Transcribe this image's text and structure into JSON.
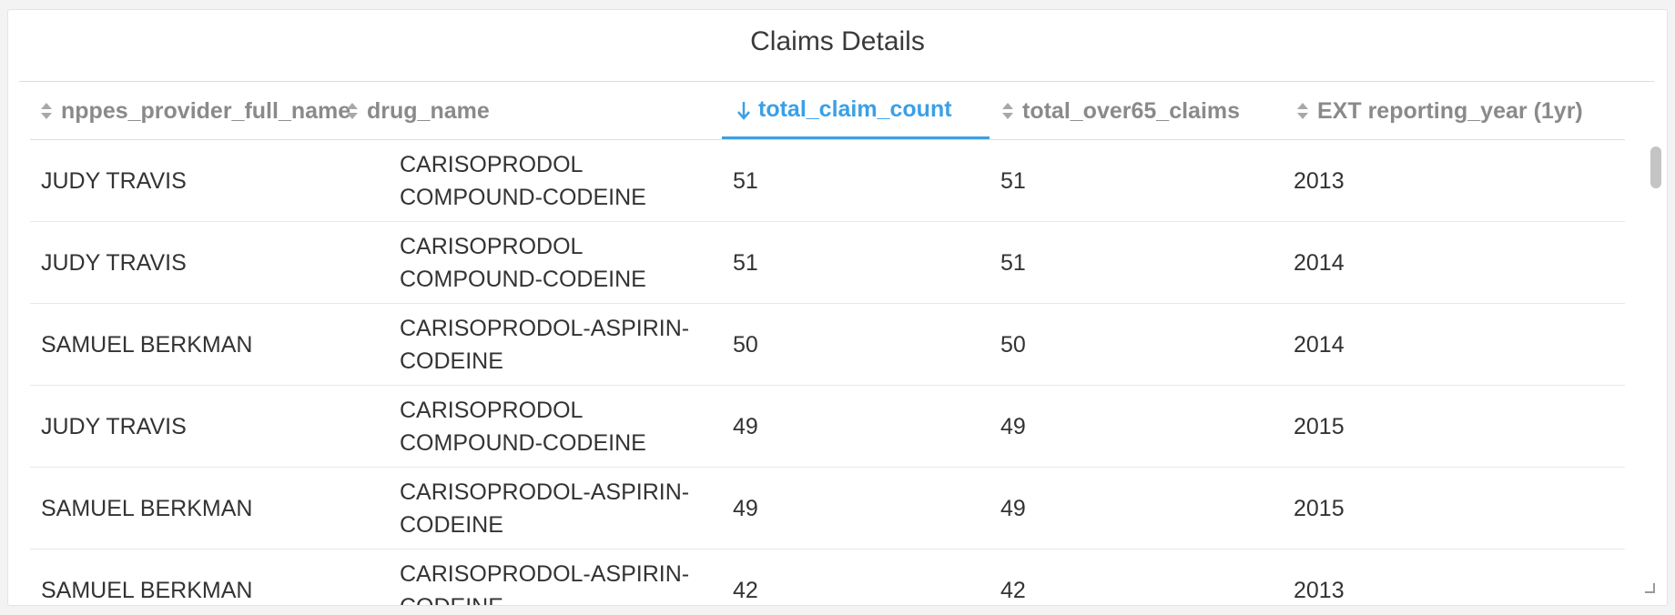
{
  "panel": {
    "title": "Claims Details"
  },
  "table": {
    "columns": [
      {
        "label": "nppes_provider_full_name",
        "sort": "none"
      },
      {
        "label": "drug_name",
        "sort": "none"
      },
      {
        "label": "total_claim_count",
        "sort": "desc"
      },
      {
        "label": "total_over65_claims",
        "sort": "none"
      },
      {
        "label": "EXT reporting_year (1yr)",
        "sort": "none"
      }
    ],
    "rows": [
      {
        "provider": "JUDY TRAVIS",
        "drug_line1": "CARISOPRODOL",
        "drug_line2": "COMPOUND-CODEINE",
        "total_claim_count": "51",
        "total_over65_claims": "51",
        "year": "2013"
      },
      {
        "provider": "JUDY TRAVIS",
        "drug_line1": "CARISOPRODOL",
        "drug_line2": "COMPOUND-CODEINE",
        "total_claim_count": "51",
        "total_over65_claims": "51",
        "year": "2014"
      },
      {
        "provider": "SAMUEL BERKMAN",
        "drug_line1": "CARISOPRODOL-ASPIRIN-",
        "drug_line2": "CODEINE",
        "total_claim_count": "50",
        "total_over65_claims": "50",
        "year": "2014"
      },
      {
        "provider": "JUDY TRAVIS",
        "drug_line1": "CARISOPRODOL",
        "drug_line2": "COMPOUND-CODEINE",
        "total_claim_count": "49",
        "total_over65_claims": "49",
        "year": "2015"
      },
      {
        "provider": "SAMUEL BERKMAN",
        "drug_line1": "CARISOPRODOL-ASPIRIN-",
        "drug_line2": "CODEINE",
        "total_claim_count": "49",
        "total_over65_claims": "49",
        "year": "2015"
      },
      {
        "provider": "SAMUEL BERKMAN",
        "drug_line1": "CARISOPRODOL-ASPIRIN-",
        "drug_line2": "CODEINE",
        "total_claim_count": "42",
        "total_over65_claims": "42",
        "year": "2013"
      }
    ]
  },
  "colors": {
    "accent": "#3aa0e6",
    "header_text": "#8a8a8a",
    "cell_text": "#333333"
  },
  "icons": {
    "sort_none": "sort-both-icon",
    "sort_desc": "sort-desc-arrow-icon",
    "resize": "resize-handle-icon"
  }
}
